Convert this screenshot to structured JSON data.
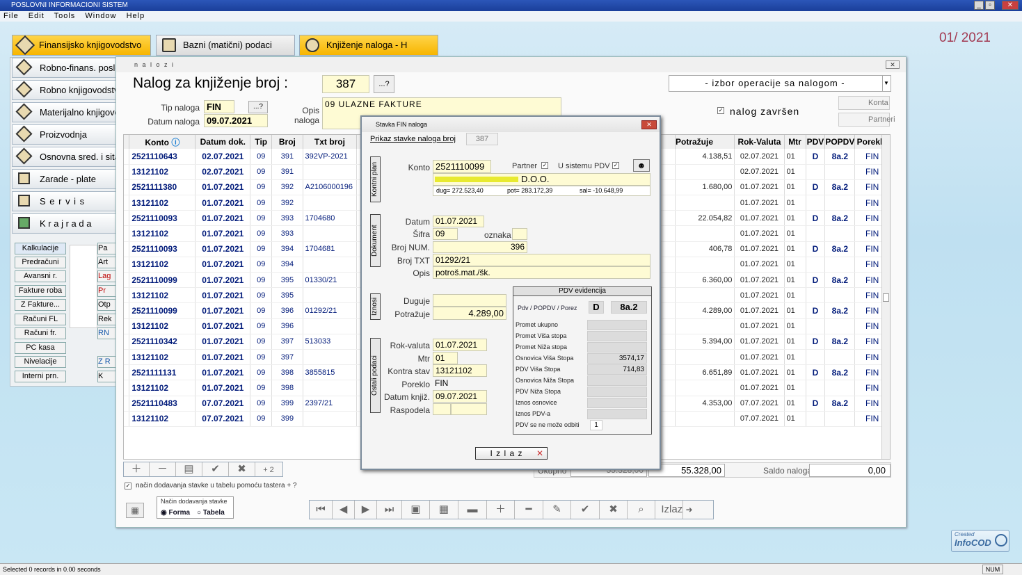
{
  "app": {
    "title": "POSLOVNI  INFORMACIONI  SISTEM",
    "period": "01/ 2021",
    "status": "Selected 0 records in 0.00 seconds",
    "num": "NUM"
  },
  "menu": [
    "File",
    "Edit",
    "Tools",
    "Window",
    "Help"
  ],
  "topbuttons": [
    "Finansijsko knjigovodstvo",
    "Bazni (matični) podaci",
    "Knjiženje naloga - H"
  ],
  "leftmenu": [
    "Robno-finans. poslovanje",
    "Robno knjigovodstvo",
    "Materijalno knjigovodstvo",
    "Proizvodnja",
    "Osnovna sred. i sitan inv.",
    "Zarade - plate",
    "S e r v i s",
    "K r a j   r a d a"
  ],
  "smallbtns": [
    "Kalkulacije",
    "Predračuni",
    "Avansni r.",
    "Fakture roba",
    "Z Fakture...",
    "Računi FL",
    "Računi fr.",
    "PC kasa",
    "Nivelacije",
    "Interni prn."
  ],
  "smallbtns2": [
    "Pa",
    "Art",
    "Lag",
    "Pr",
    "Otp",
    "Rek",
    "RN",
    "",
    "Z R",
    "K"
  ],
  "win": {
    "title": "n a l o z i",
    "heading": "Nalog za knjiženje broj :",
    "number": "387",
    "lookup": "...?",
    "ops": "- izbor operacije sa nalogom -",
    "tip_label": "Tip naloga",
    "tip": "FIN",
    "tip_lookup": "...?",
    "datum_label": "Datum naloga",
    "datum": "09.07.2021",
    "opis_label": "Opis\nnaloga",
    "opis": "09  ULAZNE FAKTURE",
    "zavrsen": "nalog završen",
    "konta": "Konta",
    "partneri": "Partneri",
    "ukupno": "Ukupno",
    "ukupno_d": "55.328,00",
    "ukupno_p": "55.328,00",
    "saldo_label": "Saldo naloga",
    "saldo": "0,00",
    "check_text": "način dodavanja stavke u tabelu pomoću tastera + ?",
    "nacin_title": "Način dodavanja stavke",
    "forma": "Forma",
    "tabela": "Tabela",
    "izlaz": "Izlaz",
    "plus2": "+ 2"
  },
  "columns": {
    "konto": "Konto",
    "datum": "Datum dok.",
    "tip": "Tip",
    "broj": "Broj",
    "txt": "Txt broj",
    "potrazuje": "Potražuje",
    "rok": "Rok-Valuta",
    "mtr": "Mtr",
    "pdv": "PDV",
    "popdv": "POPDV",
    "poreklo": "Poreklo"
  },
  "rows": [
    [
      "2521110643",
      "02.07.2021",
      "09",
      "391",
      "392VP-2021",
      "4.138,51",
      "02.07.2021",
      "01",
      "D",
      "8a.2",
      "FIN"
    ],
    [
      "13121102",
      "02.07.2021",
      "09",
      "391",
      "",
      "",
      "02.07.2021",
      "01",
      "",
      "",
      "FIN"
    ],
    [
      "2521111380",
      "01.07.2021",
      "09",
      "392",
      "A2106000196",
      "1.680,00",
      "01.07.2021",
      "01",
      "D",
      "8a.2",
      "FIN"
    ],
    [
      "13121102",
      "01.07.2021",
      "09",
      "392",
      "",
      "",
      "01.07.2021",
      "01",
      "",
      "",
      "FIN"
    ],
    [
      "2521110093",
      "01.07.2021",
      "09",
      "393",
      "1704680",
      "22.054,82",
      "01.07.2021",
      "01",
      "D",
      "8a.2",
      "FIN"
    ],
    [
      "13121102",
      "01.07.2021",
      "09",
      "393",
      "",
      "",
      "01.07.2021",
      "01",
      "",
      "",
      "FIN"
    ],
    [
      "2521110093",
      "01.07.2021",
      "09",
      "394",
      "1704681",
      "406,78",
      "01.07.2021",
      "01",
      "D",
      "8a.2",
      "FIN"
    ],
    [
      "13121102",
      "01.07.2021",
      "09",
      "394",
      "",
      "",
      "01.07.2021",
      "01",
      "",
      "",
      "FIN"
    ],
    [
      "2521110099",
      "01.07.2021",
      "09",
      "395",
      "01330/21",
      "6.360,00",
      "01.07.2021",
      "01",
      "D",
      "8a.2",
      "FIN"
    ],
    [
      "13121102",
      "01.07.2021",
      "09",
      "395",
      "",
      "",
      "01.07.2021",
      "01",
      "",
      "",
      "FIN"
    ],
    [
      "2521110099",
      "01.07.2021",
      "09",
      "396",
      "01292/21",
      "4.289,00",
      "01.07.2021",
      "01",
      "D",
      "8a.2",
      "FIN"
    ],
    [
      "13121102",
      "01.07.2021",
      "09",
      "396",
      "",
      "",
      "01.07.2021",
      "01",
      "",
      "",
      "FIN"
    ],
    [
      "2521110342",
      "01.07.2021",
      "09",
      "397",
      "513033",
      "5.394,00",
      "01.07.2021",
      "01",
      "D",
      "8a.2",
      "FIN"
    ],
    [
      "13121102",
      "01.07.2021",
      "09",
      "397",
      "",
      "",
      "01.07.2021",
      "01",
      "",
      "",
      "FIN"
    ],
    [
      "2521111131",
      "01.07.2021",
      "09",
      "398",
      "3855815",
      "6.651,89",
      "01.07.2021",
      "01",
      "D",
      "8a.2",
      "FIN"
    ],
    [
      "13121102",
      "01.07.2021",
      "09",
      "398",
      "",
      "",
      "01.07.2021",
      "01",
      "",
      "",
      "FIN"
    ],
    [
      "2521110483",
      "07.07.2021",
      "09",
      "399",
      "2397/21",
      "4.353,00",
      "07.07.2021",
      "01",
      "D",
      "8a.2",
      "FIN"
    ],
    [
      "13121102",
      "07.07.2021",
      "09",
      "399",
      "",
      "",
      "07.07.2021",
      "01",
      "",
      "",
      "FIN"
    ]
  ],
  "dlg": {
    "title": "Stavka FIN naloga",
    "prikaz": "Prikaz stavke naloga  broj",
    "broj": "387",
    "kontni_plan": "Kontni plan",
    "konto_label": "Konto",
    "konto": "2521110099",
    "partner_label": "Partner",
    "usistemu_label": "U sistemu PDV",
    "partner_name": "D.O.O.",
    "dug": "dug= 272.523,40",
    "pot": "pot= 283.172,39",
    "sal": "sal= -10.648,99",
    "dokument": "Dokument",
    "datum_label": "Datum",
    "datum": "01.07.2021",
    "sifra_label": "Šifra",
    "sifra": "09",
    "oznaka_label": "oznaka",
    "brojnum_label": "Broj NUM.",
    "brojnum": "396",
    "brojtxt_label": "Broj TXT",
    "brojtxt": "01292/21",
    "opis_label": "Opis",
    "opis": "potroš.mat./šk.",
    "iznosi": "Iznosi",
    "duguje_label": "Duguje",
    "potrazuje_label": "Potražuje",
    "potrazuje": "4.289,00",
    "ostali": "Ostali podaci",
    "rok_label": "Rok-valuta",
    "rok": "01.07.2021",
    "mtr_label": "Mtr",
    "mtr": "01",
    "kontra_label": "Kontra stav",
    "kontra": "13121102",
    "poreklo_label": "Poreklo",
    "poreklo": "FIN",
    "datknj_label": "Datum knjiž.",
    "datknj": "09.07.2021",
    "raspodela_label": "Raspodela",
    "pdv_title": "PDV evidencija",
    "pdv_label": "Pdv / POPDV / Porez",
    "pdv_d": "D",
    "pdv_code": "8a.2",
    "pdv_rows": [
      "Promet ukupno",
      "Promet Viša stopa",
      "Promet Niža stopa",
      "Osnovica Viša Stopa",
      "PDV Viša Stopa",
      "Osnovica Niža Stopa",
      "PDV Niža Stopa",
      "Iznos osnovice",
      "Iznos PDV-a",
      "PDV se ne može odbiti"
    ],
    "pdv_vals": [
      "",
      "",
      "",
      "3574,17",
      "714,83",
      "",
      "",
      "",
      "",
      "1"
    ],
    "izlaz": "I z l a z"
  },
  "logo": {
    "line1": "Created",
    "line2": "InfoCOD"
  },
  "colors": {
    "accent": "#f7b500",
    "input": "#fefbd4",
    "text_blue": "#001a7a"
  }
}
